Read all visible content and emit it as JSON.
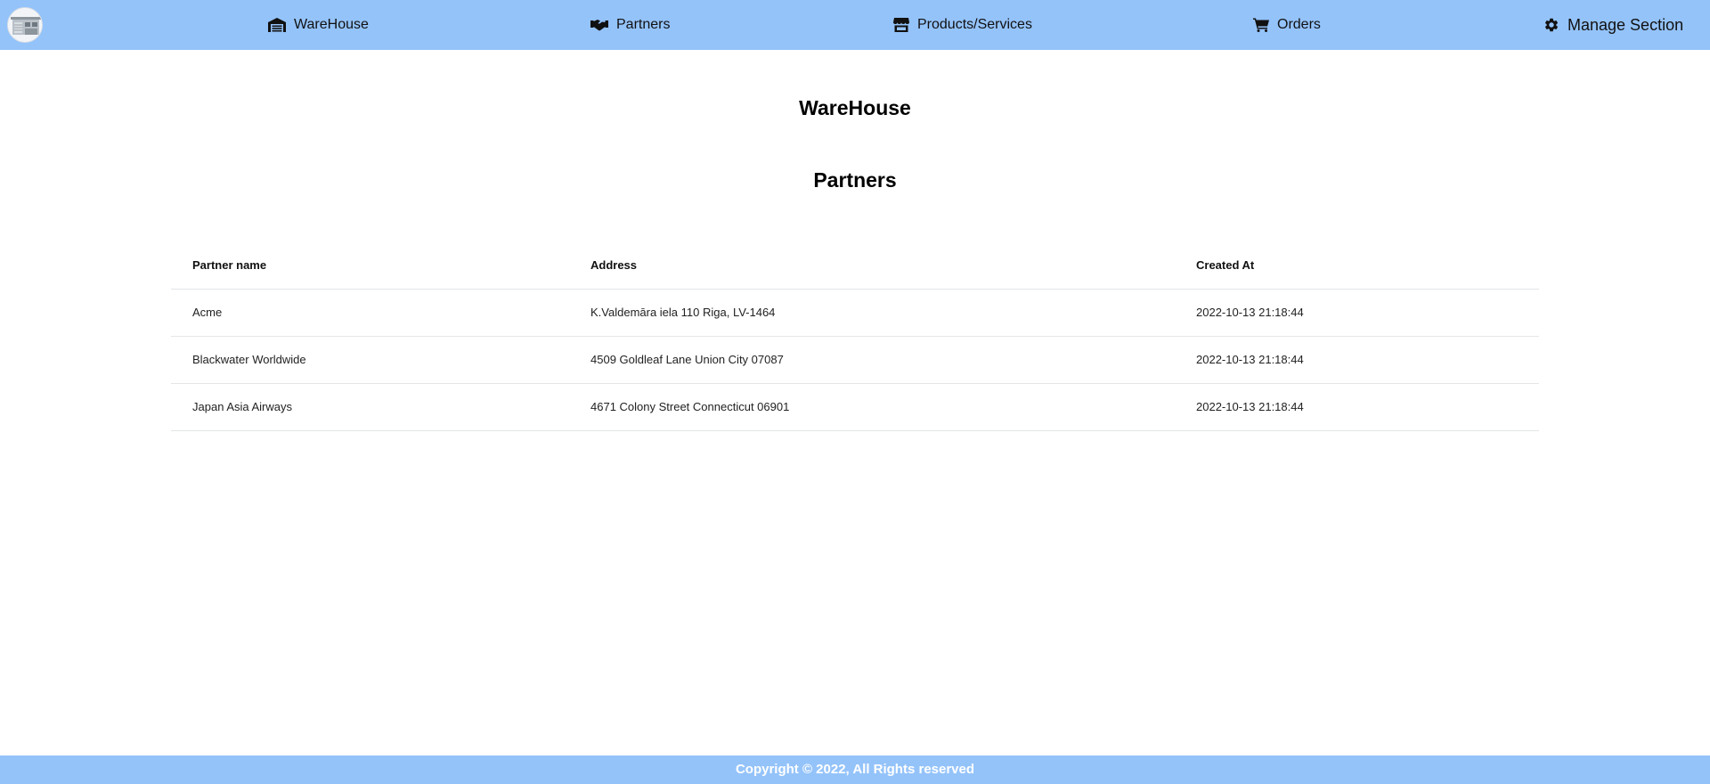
{
  "navbar": {
    "logo_icon": "warehouse-logo-icon",
    "items": [
      {
        "label": "WareHouse",
        "icon": "warehouse-icon"
      },
      {
        "label": "Partners",
        "icon": "handshake-icon"
      },
      {
        "label": "Products/Services",
        "icon": "store-icon"
      },
      {
        "label": "Orders",
        "icon": "cart-icon"
      },
      {
        "label": "Manage Section",
        "icon": "gear-icon"
      }
    ]
  },
  "main": {
    "app_title": "WareHouse",
    "section_title": "Partners"
  },
  "table": {
    "headers": [
      "Partner name",
      "Address",
      "Created At"
    ],
    "rows": [
      {
        "name": "Acme",
        "address": "K.Valdemāra iela 110 Riga, LV-1464",
        "created_at": "2022-10-13 21:18:44"
      },
      {
        "name": "Blackwater Worldwide",
        "address": "4509 Goldleaf Lane Union City 07087",
        "created_at": "2022-10-13 21:18:44"
      },
      {
        "name": "Japan Asia Airways",
        "address": "4671 Colony Street Connecticut 06901",
        "created_at": "2022-10-13 21:18:44"
      }
    ]
  },
  "footer": {
    "text": "Copyright © 2022, All Rights reserved"
  },
  "colors": {
    "navbar_bg": "#94c3fa",
    "footer_bg": "#94c3fa",
    "footer_text": "#ffffff",
    "row_border": "#e3e5e8"
  }
}
